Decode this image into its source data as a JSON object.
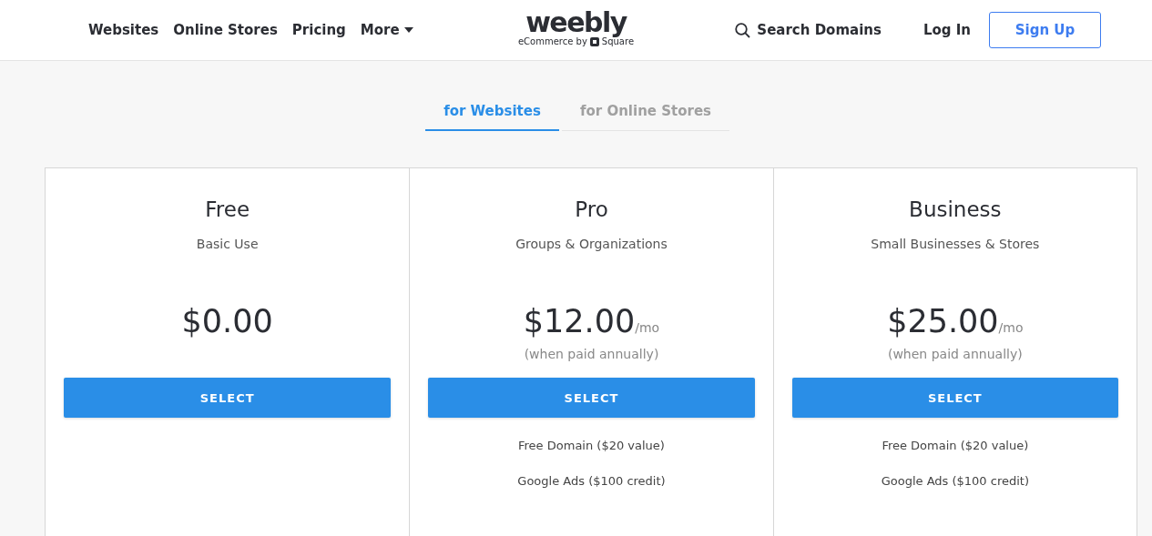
{
  "nav": {
    "links": [
      "Websites",
      "Online Stores",
      "Pricing"
    ],
    "more": "More",
    "logo": {
      "wordmark": "weebly",
      "tagline_before": "eCommerce by",
      "tagline_brand": "Square"
    },
    "search": "Search Domains",
    "login": "Log In",
    "signup": "Sign Up"
  },
  "tabs": [
    {
      "label": "for Websites",
      "selected": true
    },
    {
      "label": "for Online Stores",
      "selected": false
    }
  ],
  "plans": [
    {
      "name": "Free",
      "audience": "Basic Use",
      "price": "$0.00",
      "button": "SELECT"
    },
    {
      "name": "Pro",
      "audience": "Groups & Organizations",
      "price": "$12.00",
      "period": "/mo",
      "note": "(when paid annually)",
      "button": "SELECT",
      "features": [
        "Free Domain ($20 value)",
        "Google Ads ($100 credit)"
      ]
    },
    {
      "name": "Business",
      "audience": "Small Businesses & Stores",
      "price": "$25.00",
      "period": "/mo",
      "note": "(when paid annually)",
      "button": "SELECT",
      "features": [
        "Free Domain ($20 value)",
        "Google Ads ($100 credit)"
      ]
    }
  ]
}
